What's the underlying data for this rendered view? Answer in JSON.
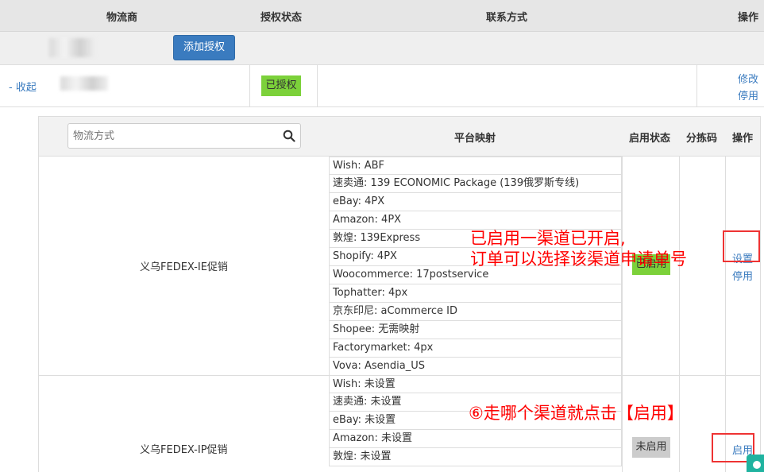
{
  "header": {
    "col_carrier": "物流商",
    "col_auth": "授权状态",
    "col_contact": "联系方式",
    "col_action": "操作"
  },
  "account": {
    "add_auth_label": "添加授权"
  },
  "provider": {
    "collapse_label": "- 收起",
    "auth_status": "已授权",
    "edit_label": "修改",
    "disable_label": "停用"
  },
  "channels_table": {
    "search_placeholder": "物流方式",
    "col_mapping": "平台映射",
    "col_status": "启用状态",
    "col_sort_code": "分拣码",
    "col_action": "操作"
  },
  "channels": [
    {
      "name": "义乌FEDEX-IE促销",
      "status": "已启用",
      "action_primary": "设置",
      "action_secondary": "停用",
      "mappings": [
        "Wish:  ABF",
        "速卖通:  139 ECONOMIC Package (139俄罗斯专线)",
        "eBay:  4PX",
        "Amazon:  4PX",
        "敦煌:  139Express",
        "Shopify:  4PX",
        "Woocommerce:  17postservice",
        "Tophatter:  4px",
        "京东印尼:  aCommerce ID",
        "Shopee:  无需映射",
        "Factorymarket:  4px",
        "Vova:  Asendia_US"
      ]
    },
    {
      "name": "义乌FEDEX-IP促销",
      "status": "未启用",
      "action_primary": "启用",
      "mappings": [
        "Wish:  未设置",
        "速卖通:  未设置",
        "eBay:  未设置",
        "Amazon:  未设置",
        "敦煌:  未设置"
      ]
    }
  ],
  "annotations": {
    "note1_line1": "已启用一渠道已开启,",
    "note1_line2": "订单可以选择该渠道申请单号",
    "note2": "⑥走哪个渠道就点击【启用】"
  },
  "colors": {
    "accent_blue": "#3a7bbf",
    "enabled_green": "#7cd13a",
    "disabled_gray": "#cccccc",
    "annotation_red": "#ff0000"
  }
}
